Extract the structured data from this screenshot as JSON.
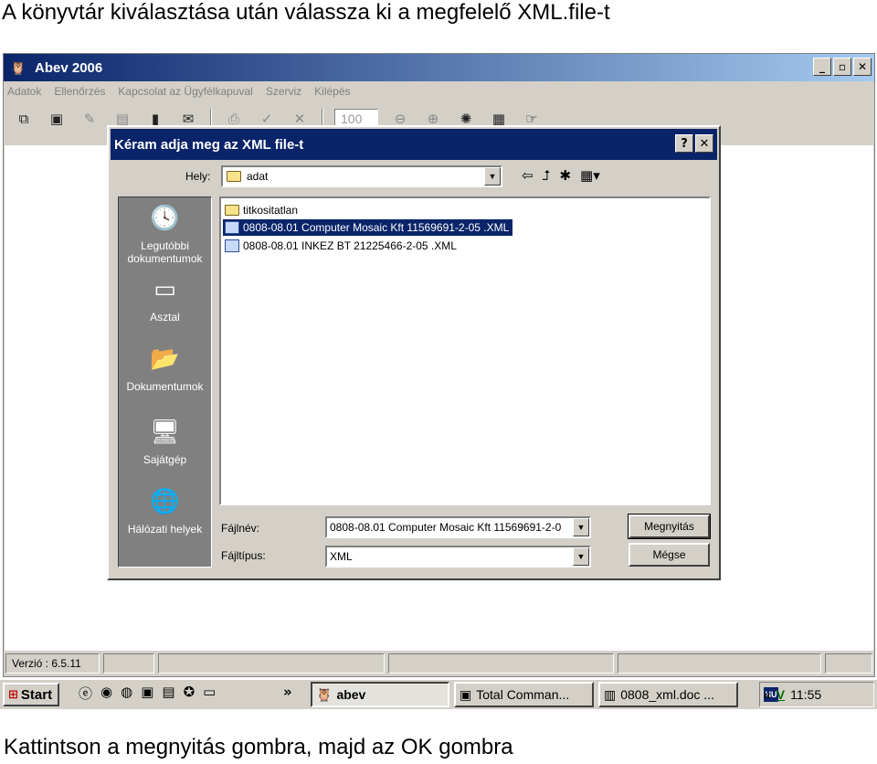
{
  "captions": {
    "top": "A könyvtár kiválasztása után válassza ki a megfelelő XML.file-t",
    "bottom": "Kattintson a megnyitás gombra, majd az OK gombra"
  },
  "app": {
    "title": "Abev 2006",
    "window_buttons": {
      "minimize": "_",
      "maximize": "▫",
      "close": "✕"
    },
    "menu": [
      "Adatok",
      "Ellenőrzés",
      "Kapcsolat az Ügyfélkapuval",
      "Szerviz",
      "Kilépés"
    ],
    "toolbar": {
      "zoom_value": "100",
      "icons": [
        "copy-icon",
        "save-icon",
        "edit-icon",
        "print-preview-icon",
        "book-icon",
        "mail-icon",
        "print-icon",
        "check-icon",
        "cross-icon",
        "zoom-out-icon",
        "zoom-in-icon",
        "settings-icon",
        "calculator-icon",
        "pointer-icon"
      ]
    },
    "status": {
      "version": "Verzió : 6.5.11"
    }
  },
  "dialog": {
    "title": "Kéram adja meg az XML file-t",
    "help_button": "?",
    "close_button": "✕",
    "location_label": "Hely:",
    "location_value": "adat",
    "places": [
      {
        "label": "Legutóbbi dokumentumok",
        "icon": "recent-documents-icon"
      },
      {
        "label": "Asztal",
        "icon": "desktop-icon"
      },
      {
        "label": "Dokumentumok",
        "icon": "my-documents-icon"
      },
      {
        "label": "Sajátgép",
        "icon": "my-computer-icon"
      },
      {
        "label": "Hálózati helyek",
        "icon": "network-places-icon"
      }
    ],
    "files": [
      {
        "name": "titkositatlan",
        "type": "folder"
      },
      {
        "name": "0808-08.01 Computer Mosaic Kft 11569691-2-05 .XML",
        "type": "xml",
        "selected": true
      },
      {
        "name": "0808-08.01 INKEZ BT 21225466-2-05 .XML",
        "type": "xml"
      }
    ],
    "filename_label": "Fájlnév:",
    "filename_value": "0808-08.01 Computer Mosaic Kft 11569691-2-0",
    "filetype_label": "Fájltípus:",
    "filetype_value": "XML",
    "open_button": "Megnyitás",
    "cancel_button": "Mégse"
  },
  "taskbar": {
    "start": "Start",
    "overflow": "»",
    "tasks": [
      {
        "label": "abev",
        "active": true
      },
      {
        "label": "Total Comman..."
      },
      {
        "label": "0808_xml.doc ..."
      }
    ],
    "tray": {
      "lang": "HU",
      "collapse": "«",
      "clock": "11:55"
    }
  }
}
